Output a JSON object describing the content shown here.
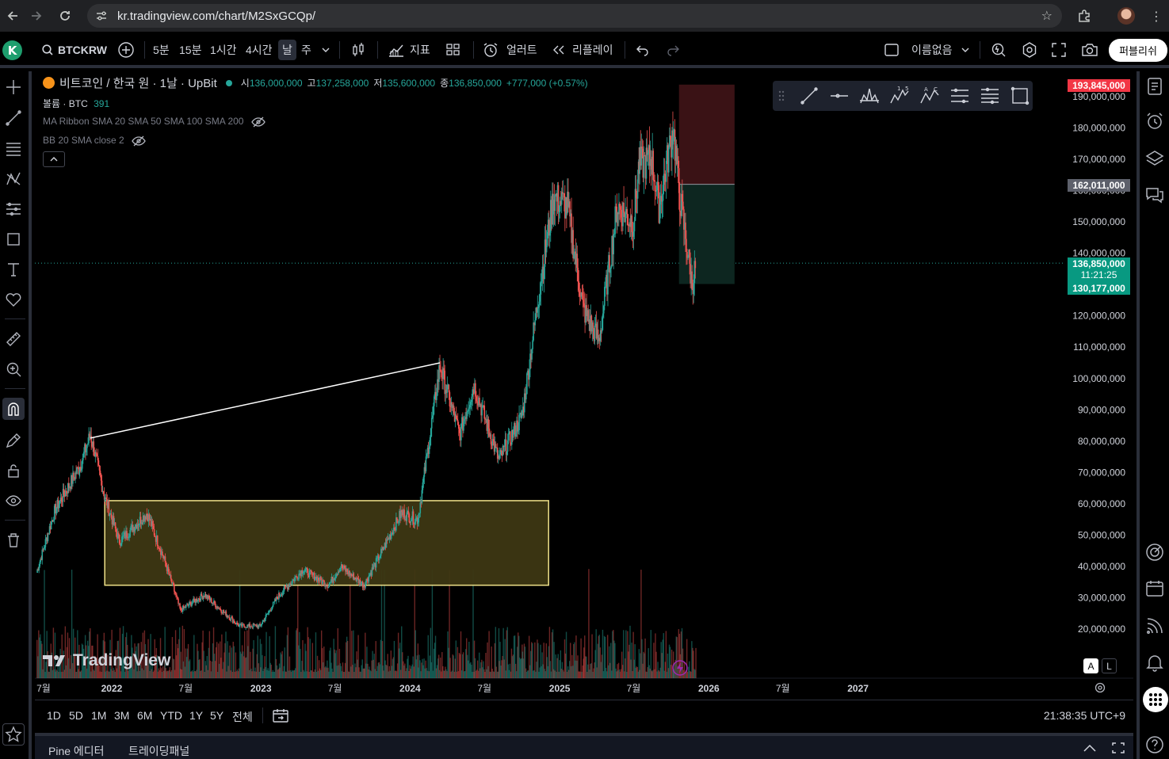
{
  "browser": {
    "url": "kr.tradingview.com/chart/M2SxGCQp/"
  },
  "toolbar": {
    "avatar_letter": "K",
    "symbol": "BTCKRW",
    "intervals": [
      "5분",
      "15분",
      "1시간",
      "4시간",
      "날",
      "주"
    ],
    "active_interval": "날",
    "indicators_label": "지표",
    "alert_label": "얼러트",
    "replay_label": "리플레이",
    "layout_name": "이름없음",
    "publish_label": "퍼블리쉬"
  },
  "legend": {
    "title": "비트코인 / 한국 원 · 1날 · UpBit",
    "o_label": "시",
    "o_value": "136,000,000",
    "h_label": "고",
    "h_value": "137,258,000",
    "l_label": "저",
    "l_value": "135,600,000",
    "c_label": "종",
    "c_value": "136,850,000",
    "change": "+777,000 (+0.57%)",
    "volume_label": "볼륨 · BTC",
    "volume_value": "391",
    "ma_ribbon": "MA Ribbon SMA 20 SMA 50 SMA 100 SMA 200",
    "bb": "BB 20 SMA close 2"
  },
  "price_tags": {
    "stop": "193,845,000",
    "entry": "162,011,000",
    "last": "136,850,000",
    "countdown": "11:21:25",
    "target": "130,177,000"
  },
  "logo_text": "TradingView",
  "scale_buttons": [
    "A",
    "L"
  ],
  "ranges": [
    "1D",
    "5D",
    "1M",
    "3M",
    "6M",
    "YTD",
    "1Y",
    "5Y",
    "전체"
  ],
  "clock": "21:38:35 UTC+9",
  "bottom_panel": {
    "pine": "Pine 에디터",
    "trading": "트레이딩패널"
  },
  "colors": {
    "up": "#26a69a",
    "down": "#ef5350",
    "short_zone": "#3a1215",
    "long_zone": "#0d2620",
    "highlight_box_fill": "#3d3713",
    "highlight_box_border": "#f0e28a",
    "trendline": "#ffffff"
  },
  "chart_data": {
    "type": "candlestick",
    "title": "비트코인 / 한국 원 · 1날 · UpBit",
    "y_ticks": [
      "190,000,000",
      "180,000,000",
      "170,000,000",
      "160,000,000",
      "150,000,000",
      "140,000,000",
      "120,000,000",
      "110,000,000",
      "100,000,000",
      "90,000,000",
      "80,000,000",
      "70,000,000",
      "60,000,000",
      "50,000,000",
      "40,000,000",
      "30,000,000",
      "20,000,000"
    ],
    "x_ticks": [
      "7월",
      "2022",
      "7월",
      "2023",
      "7월",
      "2024",
      "7월",
      "2025",
      "7월",
      "2026",
      "7월",
      "2027"
    ],
    "ylim": [
      10000000,
      195000000
    ],
    "price_path": [
      [
        "2021-07-01",
        38000000
      ],
      [
        "2021-08-15",
        58000000
      ],
      [
        "2021-10-15",
        72000000
      ],
      [
        "2021-11-10",
        82000000
      ],
      [
        "2021-12-15",
        62000000
      ],
      [
        "2022-01-20",
        48000000
      ],
      [
        "2022-03-28",
        57000000
      ],
      [
        "2022-05-10",
        42000000
      ],
      [
        "2022-06-18",
        26000000
      ],
      [
        "2022-08-15",
        31000000
      ],
      [
        "2022-11-09",
        21000000
      ],
      [
        "2022-12-30",
        21000000
      ],
      [
        "2023-02-15",
        31000000
      ],
      [
        "2023-04-14",
        39000000
      ],
      [
        "2023-06-15",
        34000000
      ],
      [
        "2023-07-15",
        40000000
      ],
      [
        "2023-09-10",
        34000000
      ],
      [
        "2023-10-25",
        45000000
      ],
      [
        "2023-12-10",
        57000000
      ],
      [
        "2024-01-20",
        55000000
      ],
      [
        "2024-03-14",
        104000000
      ],
      [
        "2024-05-01",
        82000000
      ],
      [
        "2024-06-05",
        98000000
      ],
      [
        "2024-08-05",
        74000000
      ],
      [
        "2024-10-01",
        88000000
      ],
      [
        "2024-11-12",
        128000000
      ],
      [
        "2024-12-17",
        158000000
      ],
      [
        "2025-01-20",
        155000000
      ],
      [
        "2025-02-28",
        122000000
      ],
      [
        "2025-04-07",
        112000000
      ],
      [
        "2025-05-22",
        155000000
      ],
      [
        "2025-07-01",
        150000000
      ],
      [
        "2025-07-14",
        168000000
      ],
      [
        "2025-08-14",
        170000000
      ],
      [
        "2025-09-01",
        155000000
      ],
      [
        "2025-10-06",
        180000000
      ],
      [
        "2025-10-20",
        160000000
      ],
      [
        "2025-11-21",
        130000000
      ],
      [
        "2025-12-01",
        136850000
      ]
    ],
    "trendline": [
      [
        "2021-11-10",
        81000000
      ],
      [
        "2024-03-14",
        105000000
      ]
    ],
    "highlight_box": {
      "x": [
        "2021-12-15",
        "2024-12-05"
      ],
      "y": [
        34000000,
        61000000
      ]
    },
    "position": {
      "type": "short",
      "x": [
        "2025-10-20",
        "2026-03-05"
      ],
      "stop": 193845000,
      "entry": 162011000,
      "target": 130177000
    },
    "last_price": 136850000
  }
}
